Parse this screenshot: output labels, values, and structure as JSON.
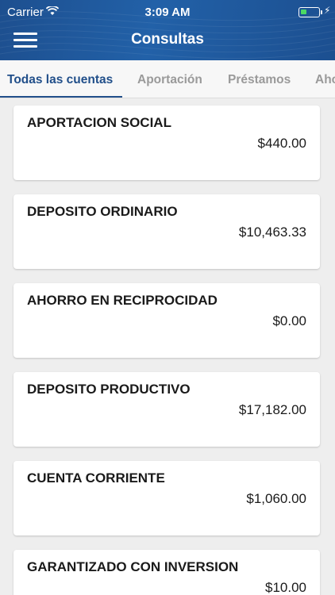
{
  "status_bar": {
    "carrier": "Carrier",
    "time": "3:09 AM",
    "battery_level": 0.35,
    "battery_color": "#4cd964"
  },
  "nav": {
    "title": "Consultas",
    "menu_icon": "hamburger-menu-icon"
  },
  "tabs": [
    {
      "label": "Todas las cuentas",
      "active": true
    },
    {
      "label": "Aportación",
      "active": false
    },
    {
      "label": "Préstamos",
      "active": false
    },
    {
      "label": "Aho",
      "active": false
    }
  ],
  "accounts": [
    {
      "name": "APORTACION SOCIAL",
      "balance": "$440.00"
    },
    {
      "name": "DEPOSITO ORDINARIO",
      "balance": "$10,463.33"
    },
    {
      "name": "AHORRO EN RECIPROCIDAD",
      "balance": "$0.00"
    },
    {
      "name": "DEPOSITO PRODUCTIVO",
      "balance": "$17,182.00"
    },
    {
      "name": "CUENTA CORRIENTE",
      "balance": "$1,060.00"
    },
    {
      "name": "GARANTIZADO CON INVERSION",
      "balance": "$10.00"
    }
  ],
  "colors": {
    "brand": "#214f8a",
    "tab_inactive": "#9a9a9a",
    "background": "#eeeeee"
  }
}
